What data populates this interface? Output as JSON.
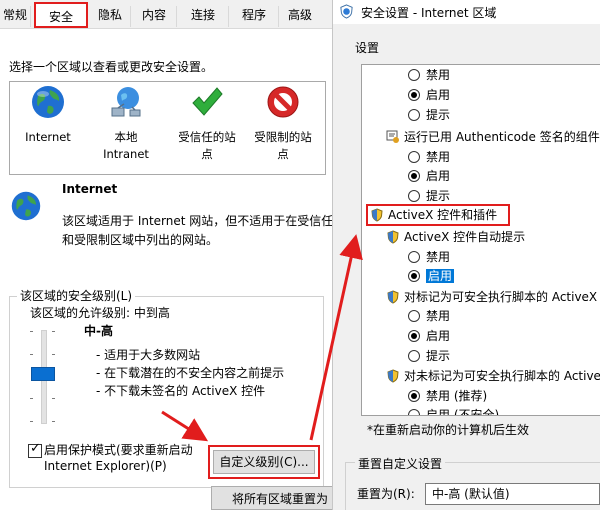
{
  "tabs": [
    "常规",
    "安全",
    "隐私",
    "内容",
    "连接",
    "程序",
    "高级"
  ],
  "active_tab": "安全",
  "left": {
    "instruction": "选择一个区域以查看或更改安全设置。",
    "zones": [
      {
        "label_line1": "Internet",
        "label_line2": "",
        "icon": "globe-icon"
      },
      {
        "label_line1": "本地",
        "label_line2": "Intranet",
        "icon": "network-globe-icon"
      },
      {
        "label_line1": "受信任的站",
        "label_line2": "点",
        "icon": "green-check-icon"
      },
      {
        "label_line1": "受限制的站",
        "label_line2": "点",
        "icon": "red-prohibited-icon"
      }
    ],
    "zone_title": "Internet",
    "zone_desc_line1": "该区域适用于 Internet 网站，但不适用于在受信任",
    "zone_desc_line2": "和受限制区域中列出的网站。",
    "level_group_title": "该区域的安全级别(L)",
    "allowed_levels": "该区域的允许级别: 中到高",
    "level_name": "中-高",
    "level_bullets": [
      "- 适用于大多数网站",
      "- 在下载潜在的不安全内容之前提示",
      "- 不下载未签名的 ActiveX 控件"
    ],
    "protected_mode_line1": "启用保护模式(要求重新启动",
    "protected_mode_line2": "Internet Explorer)(P)",
    "protected_mode_checked": true,
    "custom_level_button": "自定义级别(C)...",
    "reset_all_button": "将所有区域重置为"
  },
  "right": {
    "title": "安全设置 - Internet 区域",
    "settings_label": "设置",
    "items": [
      {
        "type": "radio",
        "label": "禁用",
        "checked": false
      },
      {
        "type": "radio",
        "label": "启用",
        "checked": true
      },
      {
        "type": "radio",
        "label": "提示",
        "checked": false
      },
      {
        "type": "header",
        "label": "运行已用 Authenticode 签名的组件"
      },
      {
        "type": "radio",
        "label": "禁用",
        "checked": false
      },
      {
        "type": "radio",
        "label": "启用",
        "checked": true
      },
      {
        "type": "radio",
        "label": "提示",
        "checked": false
      },
      {
        "type": "category",
        "label": "ActiveX 控件和插件"
      },
      {
        "type": "header",
        "label": "ActiveX 控件自动提示"
      },
      {
        "type": "radio",
        "label": "禁用",
        "checked": false
      },
      {
        "type": "radio",
        "label": "启用",
        "checked": true,
        "selected": true
      },
      {
        "type": "header",
        "label": "对标记为可安全执行脚本的 ActiveX"
      },
      {
        "type": "radio",
        "label": "禁用",
        "checked": false
      },
      {
        "type": "radio",
        "label": "启用",
        "checked": true
      },
      {
        "type": "radio",
        "label": "提示",
        "checked": false
      },
      {
        "type": "header",
        "label": "对未标记为可安全执行脚本的 Active"
      },
      {
        "type": "radio",
        "label": "禁用 (推荐)",
        "checked": true
      },
      {
        "type": "radio",
        "label": "启用 (不安全)",
        "checked": false
      }
    ],
    "restart_note": "*在重新启动你的计算机后生效",
    "reset_group_title": "重置自定义设置",
    "reset_to_label": "重置为(R):",
    "reset_to_value": "中-高 (默认值)"
  },
  "colors": {
    "accent": "#0078d7",
    "annotation_red": "#e11d1d",
    "dialog_bg": "#f0f0f0"
  }
}
